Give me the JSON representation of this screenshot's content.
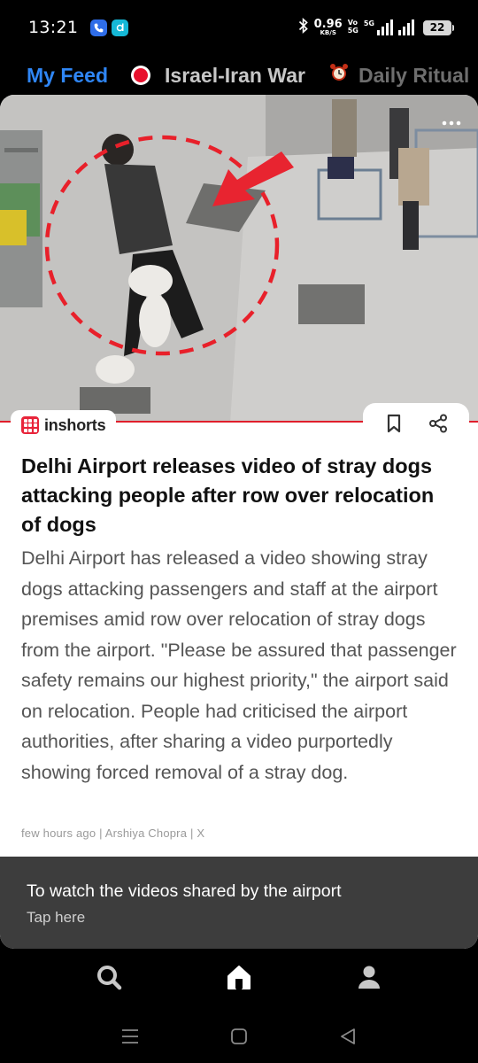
{
  "status_bar": {
    "time": "13:21",
    "net_speed_value": "0.96",
    "net_speed_unit": "KB/S",
    "volte_top": "Vo",
    "volte_bottom": "5G",
    "network_5g": "5G",
    "battery": "22",
    "icons": [
      "bluetooth-icon",
      "signal-icon",
      "battery-icon"
    ]
  },
  "tabs": [
    {
      "label": "My Feed",
      "state": "active"
    },
    {
      "label": "Israel-Iran War",
      "icon": "live-dot-icon"
    },
    {
      "label": "Daily Ritual",
      "icon": "alarm-clock-icon"
    }
  ],
  "card": {
    "media_icon": "more-dots-icon",
    "source": "inshorts",
    "headline": "Delhi Airport releases video of stray dogs attacking people after row over relocation of dogs",
    "body": "Delhi Airport has released a video showing stray dogs attacking passengers and staff at the airport premises amid row over relocation of stray dogs from the airport. \"Please be assured that passenger safety remains our highest priority,\" the airport said on relocation. People had criticised the airport authorities, after sharing a video purportedly showing forced removal of a stray dog.",
    "meta": "few hours ago | Arshiya Chopra | X",
    "cta_title": "To watch the videos shared by the airport",
    "cta_sub": "Tap here"
  },
  "bottom_nav": [
    "search-icon",
    "home-icon",
    "profile-icon"
  ],
  "colors": {
    "accent": "#2f86f5",
    "live_red": "#e8112d",
    "brand_red": "#e8253b",
    "cta_bg": "#3d3d3d"
  }
}
